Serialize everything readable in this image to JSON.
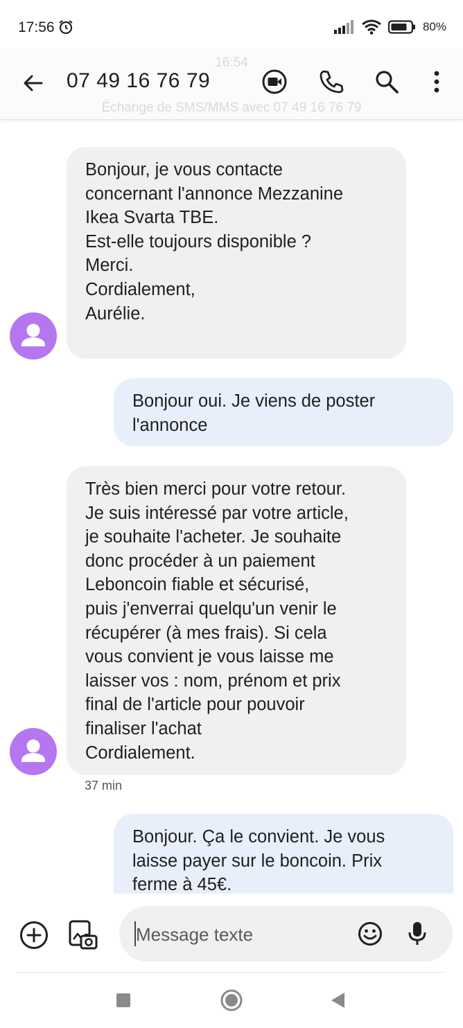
{
  "status_bar": {
    "time": "17:56",
    "battery": "80%"
  },
  "header": {
    "ghost_time": "16:54",
    "contact": "07 49 16 76 79",
    "ghost_subtitle": "Échange de SMS/MMS avec 07 49 16 76 79"
  },
  "messages": [
    {
      "direction": "incoming",
      "lines": [
        "Bonjour, je vous contacte",
        "concernant l'annonce Mezzanine",
        "Ikea Svarta TBE.",
        "Est-elle toujours disponible ?",
        "Merci.",
        "Cordialement,",
        "Aurélie."
      ]
    },
    {
      "direction": "outgoing",
      "lines": [
        "Bonjour oui. Je viens de poster",
        "l'annonce"
      ]
    },
    {
      "direction": "incoming",
      "lines": [
        "Très bien merci pour votre retour.",
        "Je suis intéressé par votre article,",
        "je souhaite l'acheter. Je souhaite",
        "donc procéder à un paiement",
        "Leboncoin fiable et sécurisé,",
        "puis j'enverrai quelqu'un venir le",
        "récupérer (à mes frais). Si cela",
        "vous convient je vous laisse me",
        "laisser vos : nom, prénom et prix",
        "final de l'article pour pouvoir",
        "finaliser l'achat",
        "Cordialement."
      ],
      "timestamp": "37 min"
    },
    {
      "direction": "outgoing",
      "lines": [
        "Bonjour. Ça le convient. Je vous",
        "laisse payer sur le boncoin. Prix",
        "ferme à 45€."
      ]
    }
  ],
  "composer": {
    "placeholder": "Message texte"
  },
  "icons": {
    "back": "arrow-left-icon",
    "video": "video-call-icon",
    "phone": "phone-icon",
    "search": "search-icon",
    "more": "more-vert-icon",
    "add": "add-circle-icon",
    "gallery": "gallery-icon",
    "emoji": "emoji-icon",
    "mic": "mic-icon"
  },
  "colors": {
    "incoming_bubble": "#f0f0f0",
    "outgoing_bubble": "#e8effb",
    "avatar": "#b576f0"
  }
}
